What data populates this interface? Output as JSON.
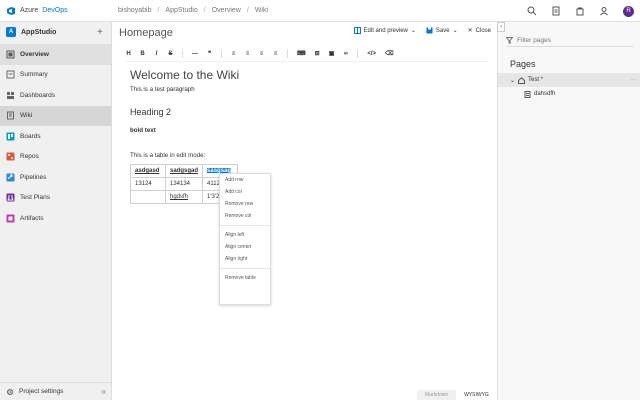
{
  "topbar": {
    "brand_prefix": "Azure",
    "brand_name": "DevOps",
    "breadcrumbs": [
      "bishoyabib",
      "AppStudio",
      "Overview",
      "Wiki"
    ],
    "avatar_initial": "R"
  },
  "sidebar": {
    "project_initial": "A",
    "project_name": "AppStudio",
    "add_symbol": "+",
    "items": [
      {
        "label": "Overview",
        "color": "#555555"
      },
      {
        "label": "Summary",
        "color": "#666666"
      },
      {
        "label": "Dashboards",
        "color": "#666666"
      },
      {
        "label": "Wiki",
        "color": "#666666"
      },
      {
        "label": "Boards",
        "color": "#009ccc"
      },
      {
        "label": "Repos",
        "color": "#e05a3a"
      },
      {
        "label": "Pipelines",
        "color": "#2b88d8"
      },
      {
        "label": "Test Plans",
        "color": "#6b2d9a"
      },
      {
        "label": "Artifacts",
        "color": "#c239b3"
      }
    ],
    "footer_label": "Project settings",
    "collapse_symbol": "«"
  },
  "main": {
    "page_title": "Homepage",
    "actions": {
      "edit_preview": "Edit and preview",
      "save": "Save",
      "close": "Close"
    },
    "toolbar": [
      "H",
      "B",
      "I",
      "S",
      "—",
      "❝",
      "≡",
      "≡",
      "≡",
      "≡",
      "⌨",
      "⊞",
      "▣",
      "∞",
      "</>",
      "⌫"
    ],
    "content": {
      "heading1": "Welcome to the Wiki",
      "paragraph1": "This is a test paragraph",
      "heading2": "Heading 2",
      "bold_text": "bold text",
      "paragraph2": "This is a table in edit mode:",
      "table": [
        [
          "asdgasd",
          "sadgsgad",
          "sasgsag"
        ],
        [
          "13124",
          "134134",
          "4112"
        ],
        [
          "",
          "hgdsfh",
          "1'3'2"
        ]
      ]
    },
    "context_menu": {
      "group1": [
        "Add row",
        "Add col",
        "Remove row",
        "Remove col"
      ],
      "group2": [
        "Align left",
        "Align center",
        "Align right"
      ],
      "group3": [
        "Remove table"
      ]
    },
    "status": {
      "markdown": "Markdown",
      "wysiwyg": "WYSIWYG"
    }
  },
  "pages_pane": {
    "toggle_symbol": "›",
    "filter_placeholder": "Filter pages",
    "title": "Pages",
    "root_page": "Test *",
    "child_page": "dahsdfh",
    "more": "···"
  }
}
